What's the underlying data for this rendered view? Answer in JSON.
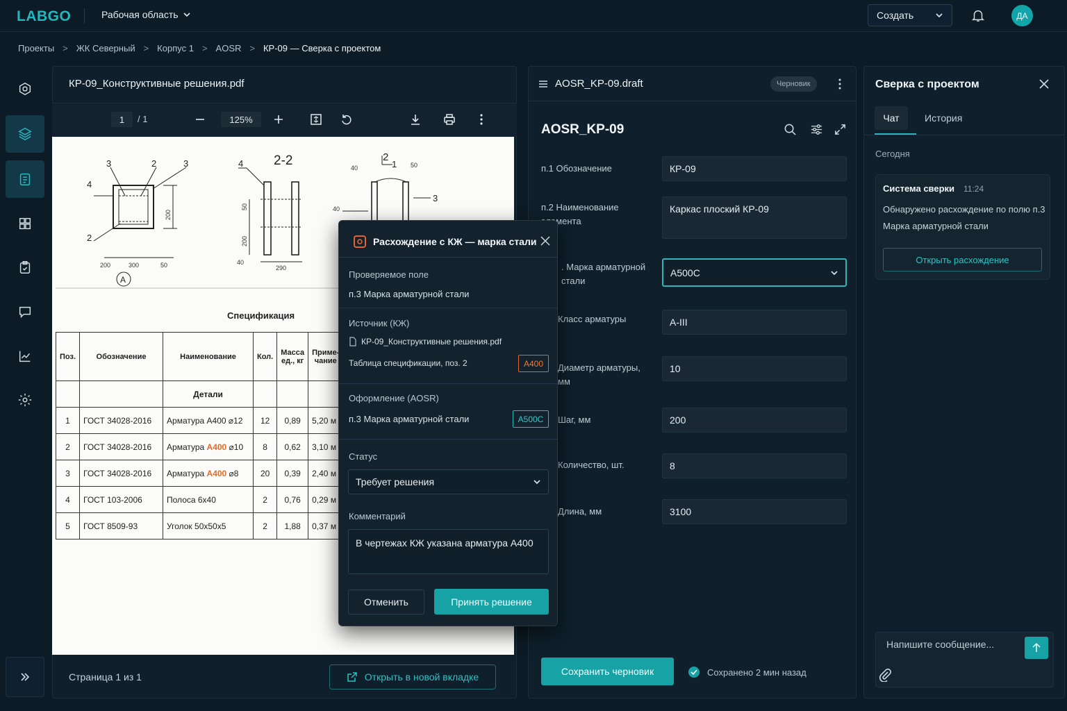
{
  "app": {
    "logo": "LABGO",
    "workspace": "Рабочая область",
    "create_label": "Создать",
    "avatar": "ДА"
  },
  "breadcrumb": [
    "Проекты",
    "ЖК Северный",
    "Корпус 1",
    "AOSR",
    "КР-09 — Сверка с проектом"
  ],
  "sidebar": [
    "logo-mark-icon",
    "layers-icon",
    "document-list-icon",
    "grid-icon",
    "clipboard-check-icon",
    "chat-icon",
    "chart-icon",
    "gear-icon"
  ],
  "pdf": {
    "title": "КР-09_Конструктивные решения.pdf",
    "page_current": "1",
    "page_total": "/ 1",
    "zoom": "125%",
    "footer": "Страница 1 из 1",
    "open_tab": "Открыть в новой вкладке",
    "drawing": {
      "section_a": {
        "callouts": [
          "3",
          "2",
          "3",
          "4",
          "2"
        ],
        "dims": [
          "200",
          "300",
          "50",
          "200"
        ],
        "marker": "А"
      },
      "section_22": {
        "title": "2-2",
        "callouts": [
          "4"
        ],
        "dims": [
          "50",
          "200",
          "40",
          "290"
        ]
      },
      "section_21": {
        "title": "2",
        "title_sub": "1",
        "callouts": [
          "3"
        ],
        "dims": [
          "40",
          "50",
          "40"
        ]
      }
    },
    "spec": {
      "title": "Спецификация",
      "headers": [
        "Поз.",
        "Обозначение",
        "Наименование",
        "Кол.",
        "Масса ед., кг",
        "Приме-чание"
      ],
      "group": "Детали",
      "rows": [
        {
          "pos": "1",
          "code": "ГОСТ 34028-2016",
          "name_pre": "Арматура А400 ",
          "name_hl": "",
          "name_post": "⌀12",
          "qty": "12",
          "mass": "0,89",
          "note": "5,20 м"
        },
        {
          "pos": "2",
          "code": "ГОСТ 34028-2016",
          "name_pre": "Арматура ",
          "name_hl": "А400",
          "name_post": " ⌀10",
          "qty": "8",
          "mass": "0,62",
          "note": "3,10 м"
        },
        {
          "pos": "3",
          "code": "ГОСТ 34028-2016",
          "name_pre": "Арматура ",
          "name_hl": "А400",
          "name_post": " ⌀8",
          "qty": "20",
          "mass": "0,39",
          "note": "2,40 м"
        },
        {
          "pos": "4",
          "code": "ГОСТ 103-2006",
          "name_pre": "Полоса 6х40",
          "name_hl": "",
          "name_post": "",
          "qty": "2",
          "mass": "0,76",
          "note": "0,29 м"
        },
        {
          "pos": "5",
          "code": "ГОСТ 8509-93",
          "name_pre": "Уголок 50х50х5",
          "name_hl": "",
          "name_post": "",
          "qty": "2",
          "mass": "1,88",
          "note": "0,37 м"
        }
      ]
    }
  },
  "draft": {
    "file": "AOSR_KP-09.draft",
    "badge": "Черновик",
    "title": "AOSR_KP-09",
    "fields": [
      {
        "label": "п.1  Обозначение",
        "value": "КР-09"
      },
      {
        "label": "п.2  Наименование элемента",
        "value": "Каркас плоский КР-09"
      },
      {
        "label": ". Марка арматурной стали",
        "value": "А500С"
      },
      {
        "label": " Класс арматуры",
        "value": "А-III"
      },
      {
        "label": " Диаметр арматуры, мм",
        "value": "10"
      },
      {
        "label": " Шаг, мм",
        "value": "200"
      },
      {
        "label": " Количество, шт.",
        "value": "8"
      },
      {
        "label": " Длина, мм",
        "value": "3100"
      }
    ],
    "save": "Сохранить черновик",
    "saved": "Сохранено 2 мин назад"
  },
  "modal": {
    "title": "Расхождение с КЖ — марка стали",
    "checked_label": "Проверяемое поле",
    "checked_value": "п.3  Марка арматурной стали",
    "source_label": "Источник (КЖ)",
    "source_file": "КР-09_Конструктивные решения.pdf",
    "source_detail": "Таблица спецификации, поз. 2",
    "source_tag": "А400",
    "aosr_label": "Оформление (AOSR)",
    "aosr_value": "п.3  Марка арматурной стали",
    "aosr_tag": "А500С",
    "status_label": "Статус",
    "status_value": "Требует решения",
    "comment_label": "Комментарий",
    "comment_value": "В чертежах КЖ указана арматура А400",
    "cancel": "Отменить",
    "accept": "Принять решение"
  },
  "chat": {
    "title": "Сверка с проектом",
    "tabs": [
      "Чат",
      "История"
    ],
    "day": "Сегодня",
    "sender": "Система сверки",
    "time": "11:24",
    "text": "Обнаружено расхождение по полю п.3 Марка арматурной стали",
    "open_btn": "Открыть расхождение",
    "placeholder": "Напишите сообщение..."
  },
  "colors": {
    "accent": "#17a2a6",
    "warning": "#e2662c",
    "bg": "#0d1b26"
  }
}
